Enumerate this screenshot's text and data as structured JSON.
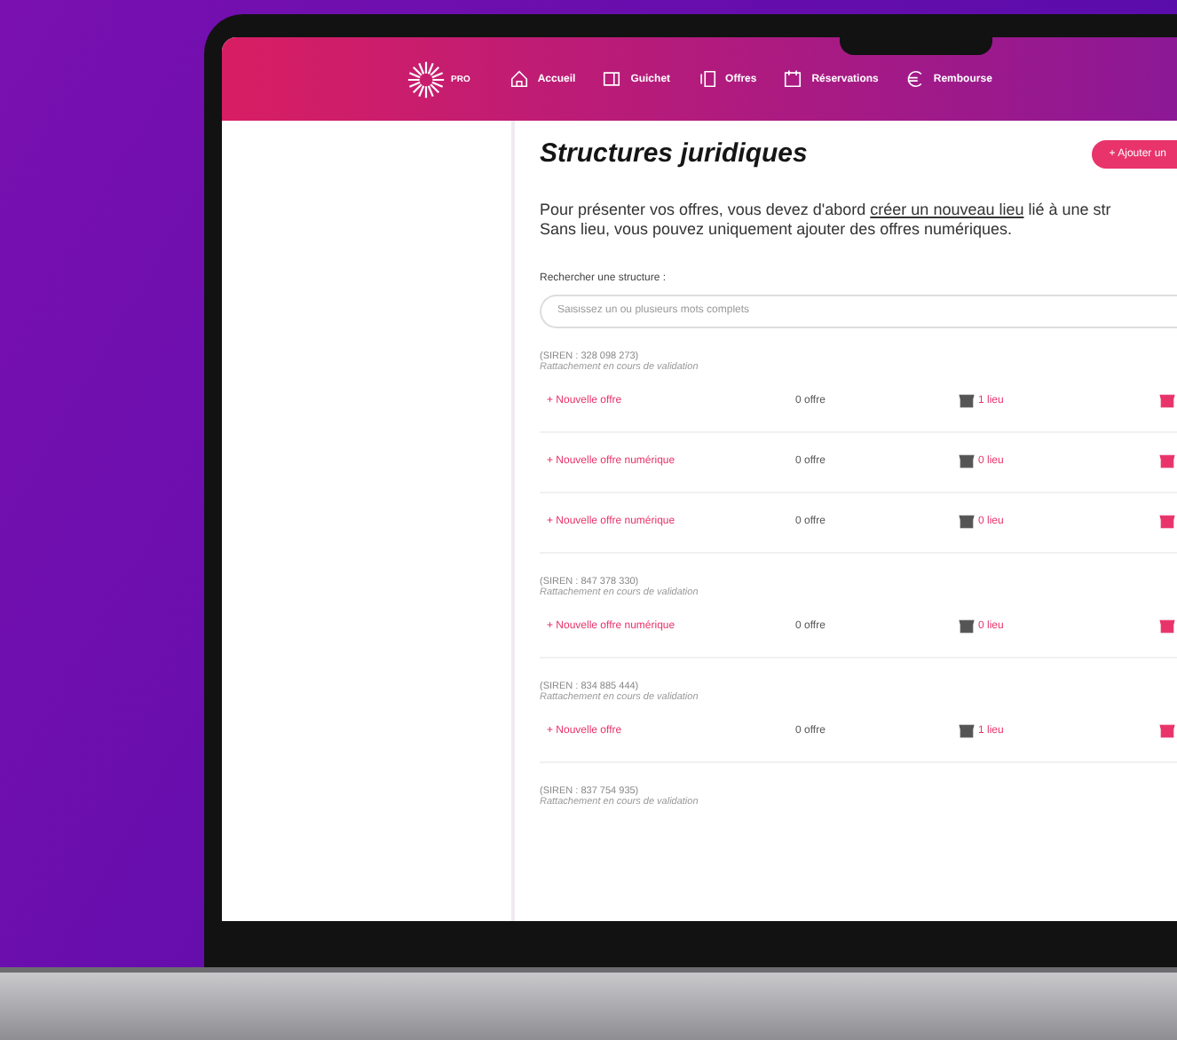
{
  "brand": {
    "label": "PRO"
  },
  "nav": [
    {
      "label": "Accueil",
      "kind": "home"
    },
    {
      "label": "Guichet",
      "kind": "desk"
    },
    {
      "label": "Offres",
      "kind": "offers"
    },
    {
      "label": "Réservations",
      "kind": "bookings"
    },
    {
      "label": "Rembourse",
      "kind": "refunds"
    }
  ],
  "page": {
    "title": "Structures juridiques",
    "add_button": "+ Ajouter un",
    "intro": {
      "before": "Pour présenter vos offres, vous devez d'abord ",
      "link": "créer un nouveau lieu",
      "after": " lié à une str",
      "line2": "Sans lieu, vous pouvez uniquement ajouter des offres numériques."
    },
    "search": {
      "label": "Rechercher une structure :",
      "placeholder": "Saisissez un ou plusieurs mots complets"
    }
  },
  "structures": [
    {
      "siren": "(SIREN : 328 098 273)",
      "status": "Rattachement en cours de validation",
      "rows": [
        {
          "action": "+ Nouvelle offre",
          "offers": "0 offre",
          "places": "1 lieu"
        },
        {
          "action": "+ Nouvelle offre numérique",
          "offers": "0 offre",
          "places": "0 lieu"
        },
        {
          "action": "+ Nouvelle offre numérique",
          "offers": "0 offre",
          "places": "0 lieu"
        }
      ]
    },
    {
      "siren": "(SIREN : 847 378 330)",
      "status": "Rattachement en cours de validation",
      "rows": [
        {
          "action": "+ Nouvelle offre numérique",
          "offers": "0 offre",
          "places": "0 lieu"
        }
      ]
    },
    {
      "siren": "(SIREN : 834 885 444)",
      "status": "Rattachement en cours de validation",
      "rows": [
        {
          "action": "+ Nouvelle offre",
          "offers": "0 offre",
          "places": "1 lieu"
        }
      ]
    },
    {
      "siren": "(SIREN : 837 754 935)",
      "status": "Rattachement en cours de validation"
    }
  ]
}
